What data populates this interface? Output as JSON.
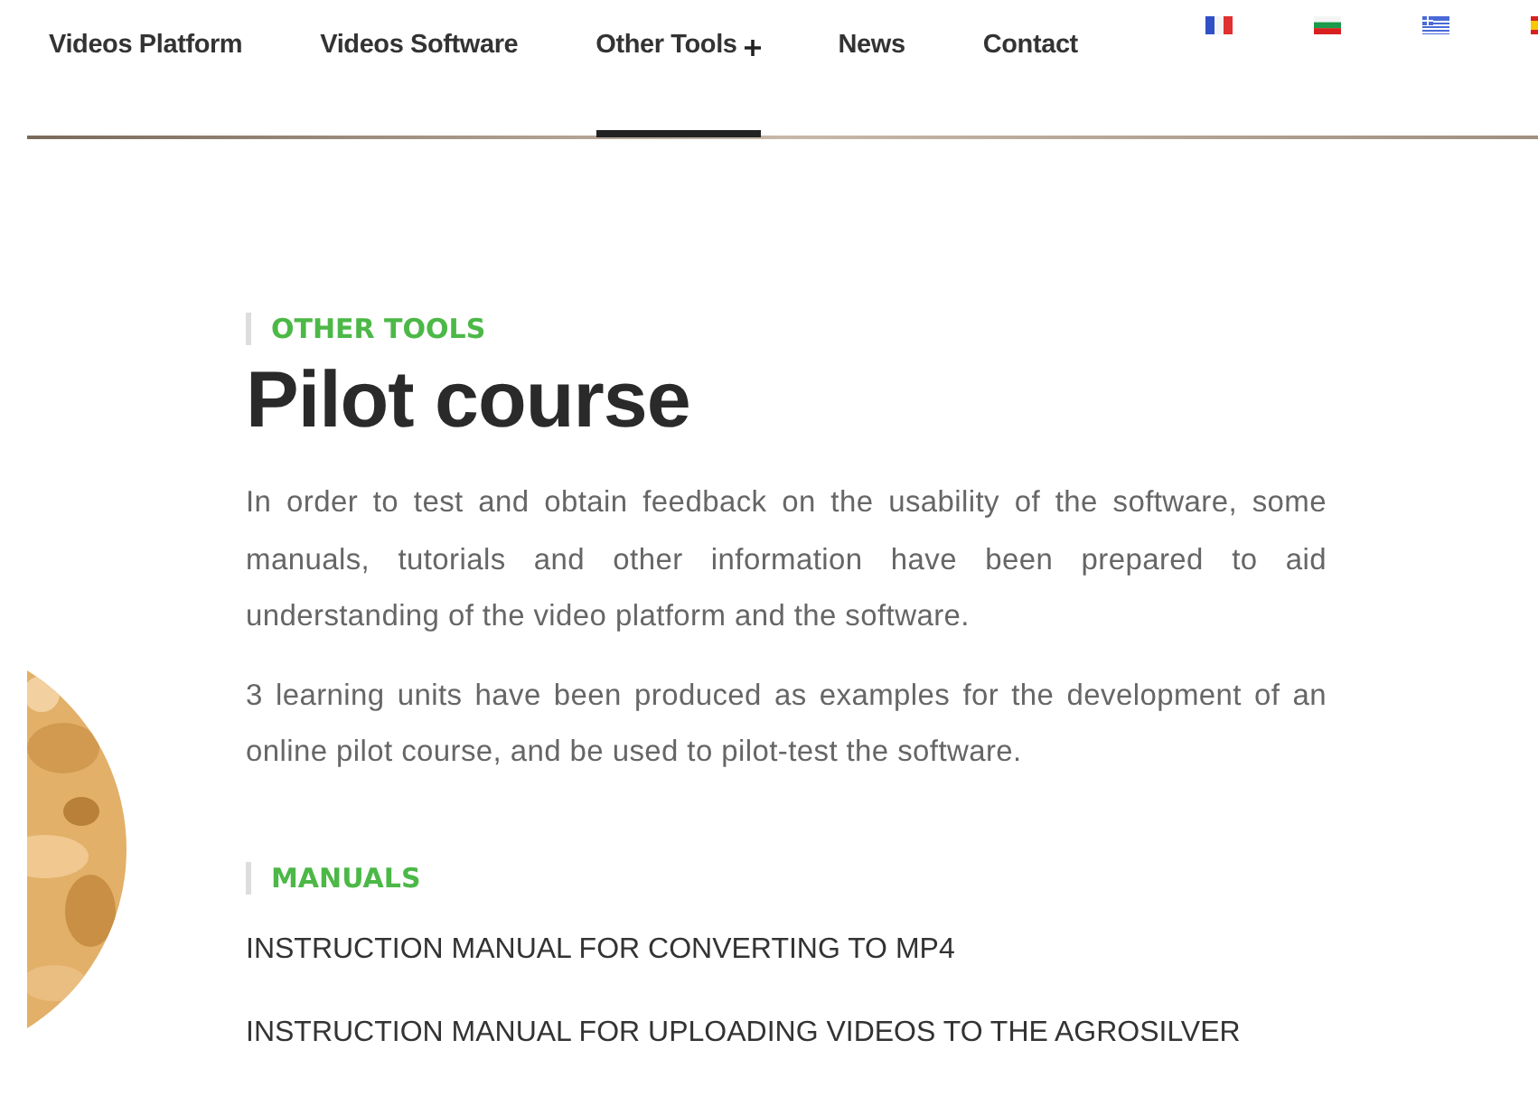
{
  "nav": {
    "items": [
      {
        "label": "Videos Platform",
        "selected": false,
        "plus": false
      },
      {
        "label": "Videos Software",
        "selected": false,
        "plus": false
      },
      {
        "label": "Other Tools",
        "selected": true,
        "plus": true
      },
      {
        "label": "News",
        "selected": false,
        "plus": false
      },
      {
        "label": "Contact",
        "selected": false,
        "plus": false
      }
    ],
    "flags": [
      {
        "kind": "fr"
      },
      {
        "kind": "bg"
      },
      {
        "kind": "gr"
      },
      {
        "kind": "es"
      }
    ]
  },
  "header": {
    "eyebrow": "OTHER TOOLS",
    "title": "Pilot course"
  },
  "paragraphs": [
    "In order to test and obtain feedback on the usability of the software, some manuals, tutorials and other information have been prepared to aid understanding of the video platform and the software.",
    "3 learning units have been produced as examples for the development of an online pilot course, and be used to pilot-test the software."
  ],
  "manuals": {
    "eyebrow": "MANUALS",
    "links": [
      "INSTRUCTION MANUAL FOR CONVERTING TO MP4",
      "INSTRUCTION MANUAL FOR UPLOADING VIDEOS TO THE AGROSILVER"
    ]
  }
}
